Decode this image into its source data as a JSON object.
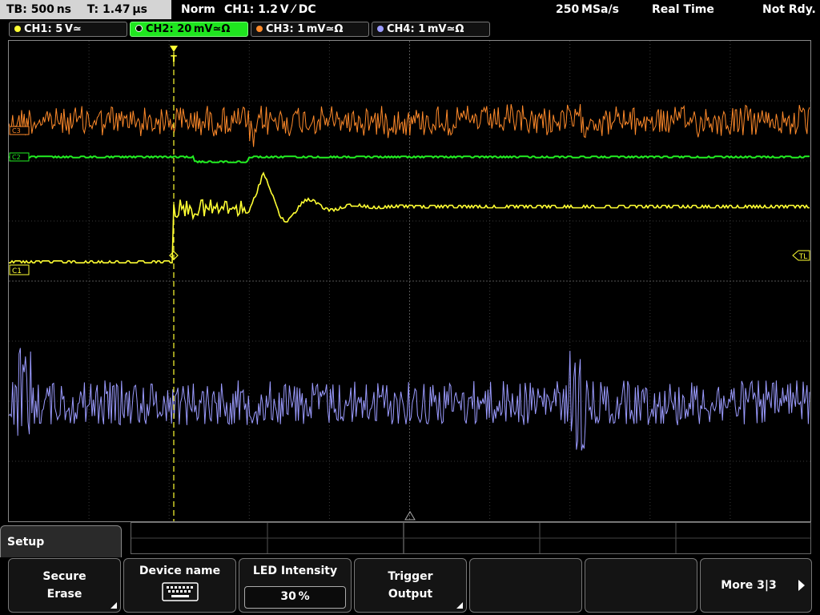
{
  "top": {
    "timebase": "TB: 500 ns",
    "trigger_time": "T: 1.47 µs",
    "mode": "Norm",
    "trigger_info": "CH1: 1.2 V ⁄ DC",
    "sample_rate": "250 MSa/s",
    "acq_mode": "Real Time",
    "status": "Not Rdy."
  },
  "channels": [
    {
      "label": "CH1: 5 V≃",
      "color": "#ffff33"
    },
    {
      "label": "CH2: 20 mV≃Ω",
      "color": "#22ee22"
    },
    {
      "label": "CH3: 1 mV≃Ω",
      "color": "#ff8a2a"
    },
    {
      "label": "CH4: 1 mV≃Ω",
      "color": "#9b9bff"
    }
  ],
  "markers": {
    "ch1": "C1",
    "ch2": "C2",
    "ch3": "C3",
    "trigger_level": "TL",
    "trigger_pos": "T"
  },
  "menu": {
    "title": "Setup",
    "softkeys": {
      "secure_erase_1": "Secure",
      "secure_erase_2": "Erase",
      "device_name": "Device name",
      "led_label": "LED Intensity",
      "led_value": "30 %",
      "trigger_output_1": "Trigger",
      "trigger_output_2": "Output",
      "more": "More 3|3"
    }
  },
  "colors": {
    "ch1": "#ffff33",
    "ch2": "#22ee22",
    "ch3": "#ff8a2a",
    "ch4": "#9b9bff",
    "grid": "#3a3a3a"
  },
  "icons": {
    "device_name": "keyboard-icon",
    "more": "arrow-right-icon",
    "submenu": "submenu-triangle-icon"
  }
}
